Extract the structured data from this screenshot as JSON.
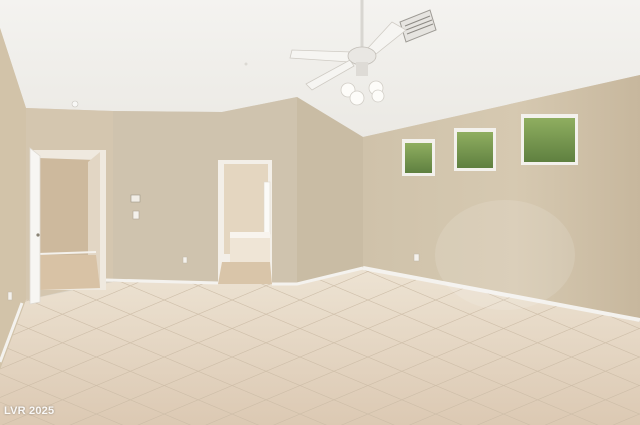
{
  "watermark": {
    "text": "LVR 2025"
  },
  "colors": {
    "ceiling": "#f1f0ec",
    "wall_left": "#d2c3ab",
    "wall_back": "#cfc4b0",
    "wall_right": "#cdbfa6",
    "floor": "#e7d8c6",
    "baseboard": "#f4f2ee",
    "window_glass": "#7a9a52"
  },
  "icons": [
    "ceiling-fan-icon",
    "air-vent-icon",
    "light-switch-icon",
    "thermostat-icon"
  ]
}
